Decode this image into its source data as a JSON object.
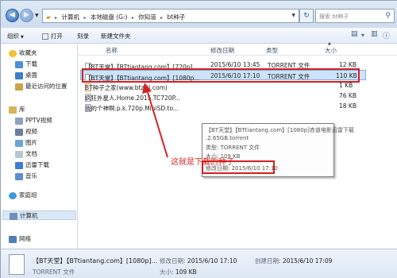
{
  "address": {
    "crumbs": [
      "计算机",
      "本地磁盘 (G:)",
      "你知道",
      "bt种子"
    ],
    "search_placeholder": "搜索 bt种子"
  },
  "toolbar": {
    "organize": "组织",
    "open": "打开",
    "burn": "刻录",
    "new_folder": "新建文件夹"
  },
  "sidebar": {
    "favorites": "收藏夹",
    "downloads": "下载",
    "desktop": "桌面",
    "recent": "最近访问的位置",
    "libraries": "库",
    "pptv": "PPTV视频",
    "videos": "视频",
    "pictures": "图片",
    "documents": "文档",
    "thunder": "迅雷下载",
    "music": "音乐",
    "homegroup": "家庭组",
    "computer": "计算机",
    "network": "网络"
  },
  "columns": {
    "name": "名称",
    "date": "修改日期",
    "type": "类型",
    "size": "大小"
  },
  "files": [
    {
      "name": "【BT天堂】【BTtiantang.com】[720p]...",
      "date": "2015/6/10 13:45",
      "type": "TORRENT 文件",
      "size": "12 KB"
    },
    {
      "name": "【BT天堂】【BTtiantang.com】[1080p...",
      "date": "2015/6/10 17:10",
      "type": "TORRENT 文件",
      "size": "110 KB"
    },
    {
      "name": "BT种子之家(www.btzzjj.com)",
      "date": "",
      "type": "",
      "size": "1 KB"
    },
    {
      "name": "疯狂外星人.Home.2015.TC720P...",
      "date": "",
      "type": "",
      "size": "76 KB"
    },
    {
      "name": "我的个神啊.p.k.720p.MiniSD.to...",
      "date": "",
      "type": "",
      "size": "18 KB"
    }
  ],
  "tooltip": {
    "line1": "【BT天堂】【BTtiantang.com】[1080p]赤道电影迅雷下载",
    "line2": ".2.65GB.torrent",
    "line3": "类型: TORRENT 文件",
    "line4": "大小: 109 KB",
    "line5": "修改日期: 2015/6/10 17:10"
  },
  "annotation": "这就是下载的种子",
  "status": {
    "name": "【BT天堂】【BTtiantang.com】[1080p]...",
    "type": "TORRENT 文件",
    "modified_label": "修改日期:",
    "modified": "2015/6/10 17:10",
    "size_label": "大小:",
    "size": "109 KB",
    "created_label": "创建日期:",
    "created": "2015/6/10 17:09"
  },
  "colors": {
    "highlight": "#d71e1e",
    "selection": "#cde3fa"
  }
}
